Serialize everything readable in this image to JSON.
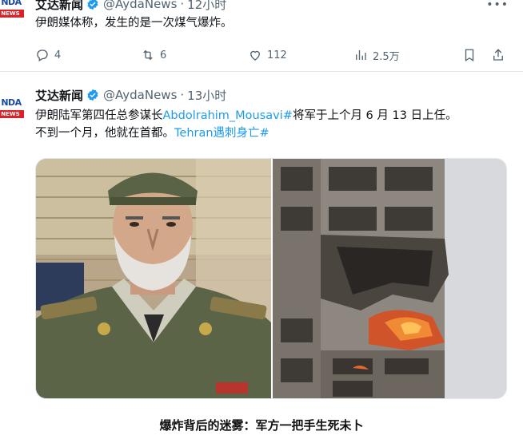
{
  "tweets": [
    {
      "author": "艾达新闻",
      "handle": "@AydaNews",
      "time": "12小时",
      "avatar_top": "NDA",
      "avatar_bottom": "NEWS",
      "text": "伊朗媒体称，发生的是一次煤气爆炸。",
      "stats": {
        "replies": "4",
        "reposts": "6",
        "likes": "112",
        "views": "2.5万"
      }
    },
    {
      "author": "艾达新闻",
      "handle": "@AydaNews",
      "time": "13小时",
      "avatar_top": "NDA",
      "avatar_bottom": "NEWS",
      "text_line1_a": "伊朗陆军第四任总参谋长",
      "text_line1_tag": "Abdolrahim_Mousavi#",
      "text_line1_b": "将军于上个月 6 月 13 日上任。",
      "text_line2_a": "不到一个月，他就在首都。",
      "text_line2_tag": "Tehran遇刺身亡#"
    }
  ],
  "caption": "爆炸背后的迷雾：军方一把手生死未卜",
  "colors": {
    "link": "#1d9bf0",
    "muted": "#536471",
    "verified": "#1d9bf0",
    "text": "#0f1419"
  },
  "icons": [
    "verified-badge-icon",
    "more-icon",
    "reply-icon",
    "repost-icon",
    "like-icon",
    "views-icon",
    "bookmark-icon",
    "share-icon"
  ]
}
